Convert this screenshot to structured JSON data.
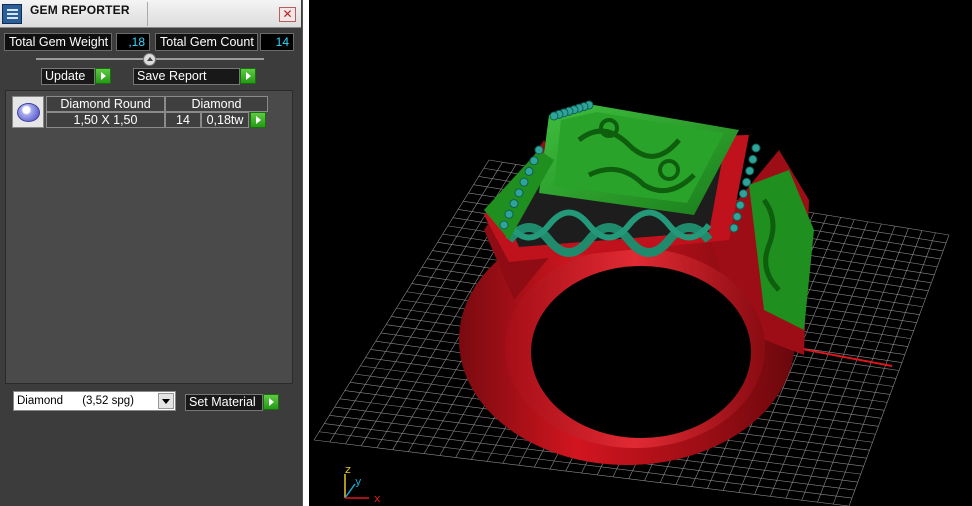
{
  "window": {
    "title": "GEM REPORTER",
    "close_glyph": "✕"
  },
  "summary": {
    "total_weight_label": "Total Gem Weight",
    "total_weight_value": ",18",
    "total_count_label": "Total Gem Count",
    "total_count_value": "14"
  },
  "actions": {
    "update_label": "Update",
    "save_report_label": "Save Report",
    "set_material_label": "Set Material"
  },
  "gem_list": [
    {
      "shape": "Diamond Round",
      "material": "Diamond",
      "size": "1,50 X 1,50",
      "count": "14",
      "weight": "0,18tw"
    }
  ],
  "material_select": {
    "selected": "Diamond      (3,52 spg)"
  },
  "viewport": {
    "axis_labels": {
      "z": "z",
      "y": "y",
      "x": "x"
    },
    "colors": {
      "metal": "#b0101a",
      "ornament": "#1f8f1f",
      "grid": "#8a8a8a",
      "x_axis": "#e0161e",
      "y_axis": "#17a9d6"
    }
  }
}
